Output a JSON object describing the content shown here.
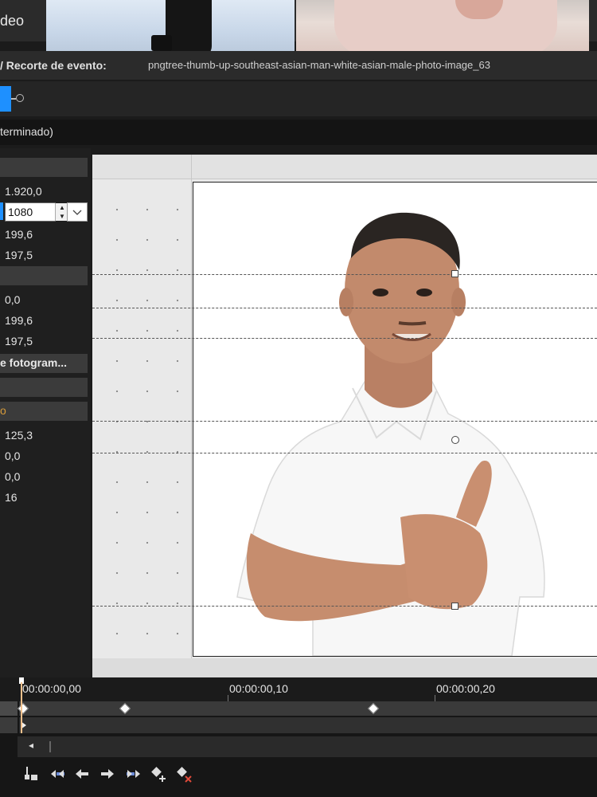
{
  "top": {
    "title_fragment": "deo"
  },
  "crop": {
    "label": "/ Recorte de evento:",
    "filename": "pngtree-thumb-up-southeast-asian-man-white-asian-male-photo-image_63"
  },
  "status": {
    "text": "terminado)"
  },
  "panel": {
    "width_value": "1.920,0",
    "height_value": "1080",
    "center_x_1": "199,6",
    "center_y_1": "197,5",
    "pos_x": "0,0",
    "center_x_2": "199,6",
    "center_y_2": "197,5",
    "keyframe_header": "e fotogram...",
    "section_marker": "o",
    "rotation_angle": "125,3",
    "rot_x": "0,0",
    "rot_y": "0,0",
    "count": "16"
  },
  "timeline": {
    "tc0": "00:00:00,00",
    "tc1": "00:00:00,10",
    "tc2": "00:00:00,20"
  },
  "toolbar": {
    "icons": [
      "lock-keyframe-icon",
      "first-keyframe-icon",
      "prev-keyframe-icon",
      "next-keyframe-icon",
      "last-keyframe-icon",
      "add-keyframe-icon",
      "delete-keyframe-icon"
    ]
  },
  "colors": {
    "accent": "#1e90ff",
    "playhead": "#f3c18c",
    "section_marker": "#d79b3a"
  }
}
